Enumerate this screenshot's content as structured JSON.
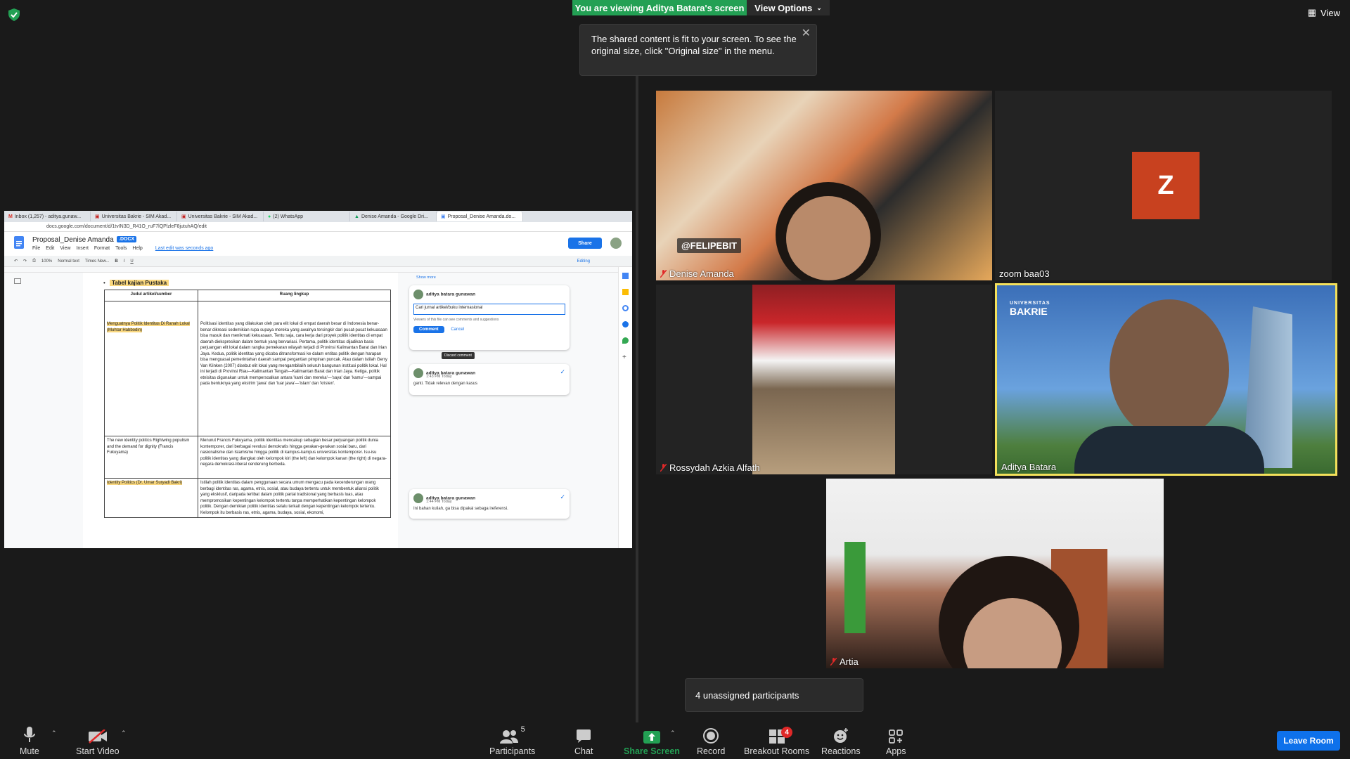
{
  "banner": {
    "viewing": "You are viewing Aditya Batara's screen",
    "view_options": "View Options",
    "tooltip": "The shared content is fit to your screen. To see the original size, click \"Original size\" in the menu.",
    "view": "View"
  },
  "shared": {
    "tabs": [
      "Inbox (1,257) - aditya.gunaw...",
      "Universitas Bakrie - SIM Akad...",
      "Universitas Bakrie - SIM Akad...",
      "(2) WhatsApp",
      "Denise Amanda - Google Dri...",
      "Proposal_Denise Amanda.do..."
    ],
    "url": "docs.google.com/document/d/1tvIN3D_R41O_ruF7lQPlzleF8jutuhAQ/edit",
    "doc_title": "Proposal_Denise Amanda",
    "doc_badge": ".DOCX",
    "menu": [
      "File",
      "Edit",
      "View",
      "Insert",
      "Format",
      "Tools",
      "Help"
    ],
    "last_edit": "Last edit was seconds ago",
    "share": "Share",
    "toolbar": [
      "100%",
      "Normal text",
      "Times New...",
      "Editing"
    ],
    "heading": "Tabel kajian Pustaka",
    "table": {
      "headers": [
        "Judul artikel/sumber",
        "Ruang lingkup"
      ],
      "rows": [
        {
          "title": "Menguatnya Politik Identitas Di Ranah Lokal (Muhtar Habbodin)",
          "scope": "Politisasi identitas yang dilakukan oleh para elit lokal di empat daerah besar di Indonesia benar-benar dikreasi sedemikian rupa supaya mereka yang awalnya tersingkir dari pusat-pusat kekuasaan bisa masuk dan menikmati kekuasaan. Tentu saja, cara kerja dari proyek politik identitas di empat daerah diekspresikan dalam bentuk yang bervariasi. Pertama, politik identitas dijadikan basis perjuangan elit lokal dalam rangka pemekaran wilayah terjadi di Provinsi Kalimantan Barat dan Irian Jaya. Kedua, politik identitas yang dicoba ditransformasi ke dalam entitas politik dengan harapan bisa menguasai pemerintahan daerah sampai pergantian pimpinan puncak. Atau dalam istilah Gerry Van Klinken (2007) disebut elit lokal yang mengambilalih seluruh bangunan institusi politik lokal. Hal ini terjadi di Provinsi Riau—Kalimantan Tengah—Kalimantan Barat dan Irian Jaya. Ketiga, politik etnisitas digunakan untuk mempersoalkan antara 'kami dan mereka'—'saya' dan 'kamu'—sampai pada bentuknya yang ekstrim 'jawa' dan 'luar jawa'—'islam' dan 'kristen'."
        },
        {
          "title": "The new identity politics Rightwing populism and the demand for dignity (Francis Fukuyama)",
          "scope": "Menurut Francis Fukuyama, politik identitas mencakup sebagian besar perjuangan politik dunia kontemporer, dari berbagai revolusi demokratis hingga gerakan-gerakan sosial baru, dari nasionalisme dan Islamisme hingga politik di kampus-kampus universitas kontemporer. Isu-isu politik identitas yang diangkat oleh kelompok kiri (the left) dan kelompok kanan (the right) di negara-negara demokrasi-liberal cenderung berbeda."
        },
        {
          "title": "Identity Politics (Dr. Umar Suryadi Bakri)",
          "scope": "Istilah politik identitas dalam penggunaan secara umum mengacu pada kecenderungan orang berbagi identitas ras, agama, etnis, sosial, atau budaya tertentu untuk membentuk aliansi politik yang eksklusif, daripada terlibat dalam politik partai tradisional yang berbasis luas, atau mempromosikan kepentingan kelompok tertentu tanpa memperhatikan kepentingan kelompok politik. Dengan demikian politik identitas selalu terkait dengan kepentingan kelompok tertentu. Kelompok itu berbasis ras, etnis, agama, budaya, sosial, ekonomi,"
        }
      ]
    },
    "comments": {
      "show_more": "Show more",
      "draft": {
        "author": "aditya batara gunawan",
        "input": "Cari jurnal artikel/buku  internasional",
        "note": "Viewers of this file can see comments and suggestions",
        "comment_btn": "Comment",
        "cancel_btn": "Cancel",
        "tooltip": "Discard comment"
      },
      "c1": {
        "author": "aditya batara gunawan",
        "time": "1:43 PM Today",
        "text": "ganti. Tidak relevan dengan kasus"
      },
      "c2": {
        "author": "aditya batara gunawan",
        "time": "1:44 PM Today",
        "text": "Ini bahan kuliah, ga bisa dipakai sebaga ireferensi."
      }
    }
  },
  "tiles": {
    "t1": {
      "name": "Denise Amanda",
      "overlay": "@FELIPEBIT"
    },
    "t2": {
      "name": "zoom baa03",
      "initial": "Z"
    },
    "t3": {
      "name": "Rossydah Azkia Alfath"
    },
    "t4": {
      "name": "Aditya Batara",
      "logo_small": "UNIVERSITAS",
      "logo": "BAKRIE"
    },
    "t5": {
      "name": "Artia"
    }
  },
  "unassigned": "4 unassigned participants",
  "toolbar": {
    "mute": "Mute",
    "start_video": "Start Video",
    "participants": "Participants",
    "participants_count": "5",
    "chat": "Chat",
    "share_screen": "Share Screen",
    "record": "Record",
    "breakout": "Breakout Rooms",
    "breakout_badge": "4",
    "reactions": "Reactions",
    "apps": "Apps",
    "leave": "Leave Room"
  },
  "colors": {
    "share_green": "#23a054",
    "leave_blue": "#0e71eb",
    "active_border": "#f3e05b",
    "avatar_z": "#c8411f"
  }
}
